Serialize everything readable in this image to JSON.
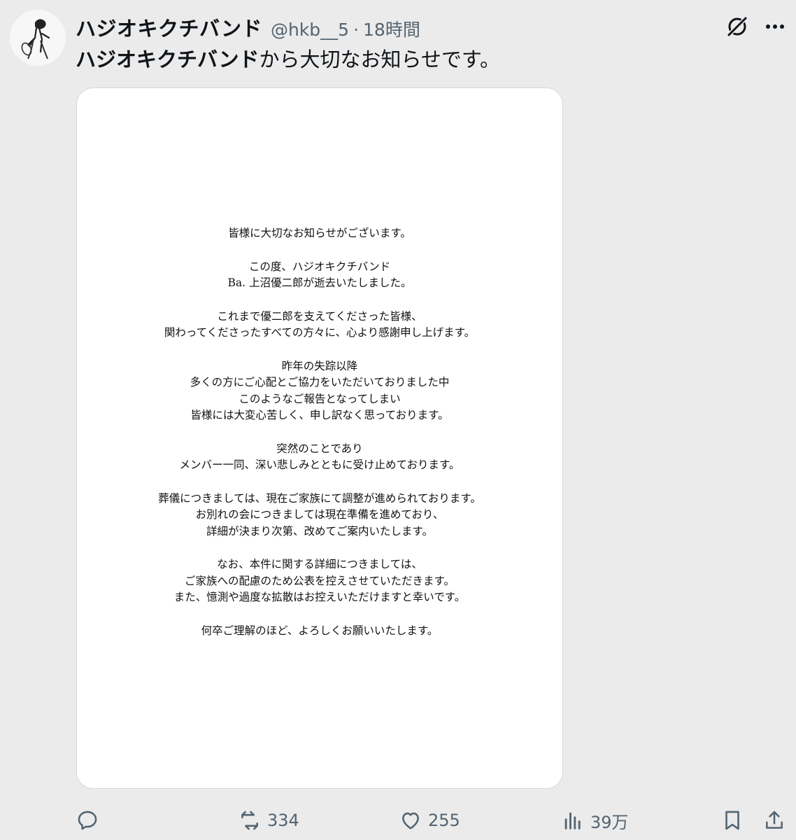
{
  "post": {
    "display_name": "ハジオキクチバンド",
    "handle": "@hkb__5",
    "separator": "·",
    "timestamp": "18時間",
    "text_bold": "ハジオキクチバンド",
    "text_rest": "から大切なお知らせです。"
  },
  "notice": {
    "paragraphs": [
      [
        "皆様に大切なお知らせがございます。"
      ],
      [
        "この度、ハジオキクチバンド",
        "Ba. 上沼優二郎が逝去いたしました。"
      ],
      [
        "これまで優二郎を支えてくださった皆様、",
        "関わってくださったすべての方々に、心より感謝申し上げます。"
      ],
      [
        "昨年の失踪以降",
        "多くの方にご心配とご協力をいただいておりました中",
        "このようなご報告となってしまい",
        "皆様には大変心苦しく、申し訳なく思っております。"
      ],
      [
        "突然のことであり",
        "メンバー一同、深い悲しみとともに受け止めております。"
      ],
      [
        "葬儀につきましては、現在ご家族にて調整が進められております。",
        "お別れの会につきましては現在準備を進めており、",
        "詳細が決まり次第、改めてご案内いたします。"
      ],
      [
        "なお、本件に関する詳細につきましては、",
        "ご家族への配慮のため公表を控えさせていただきます。",
        "また、憶測や過度な拡散はお控えいただけますと幸いです。"
      ],
      [
        "何卒ご理解のほど、よろしくお願いいたします。"
      ]
    ]
  },
  "actions": {
    "reposts": "334",
    "likes": "255",
    "views": "39万"
  },
  "icons": {
    "avatar": "avatar-illustration",
    "grok": "grok-icon",
    "more": "more-icon",
    "reply": "reply-icon",
    "repost": "repost-icon",
    "like": "heart-icon",
    "views": "views-icon",
    "bookmark": "bookmark-icon",
    "share": "share-icon"
  },
  "colors": {
    "text": "#0f1419",
    "secondary": "#536471",
    "background": "#ebebeb",
    "card": "#ffffff"
  }
}
